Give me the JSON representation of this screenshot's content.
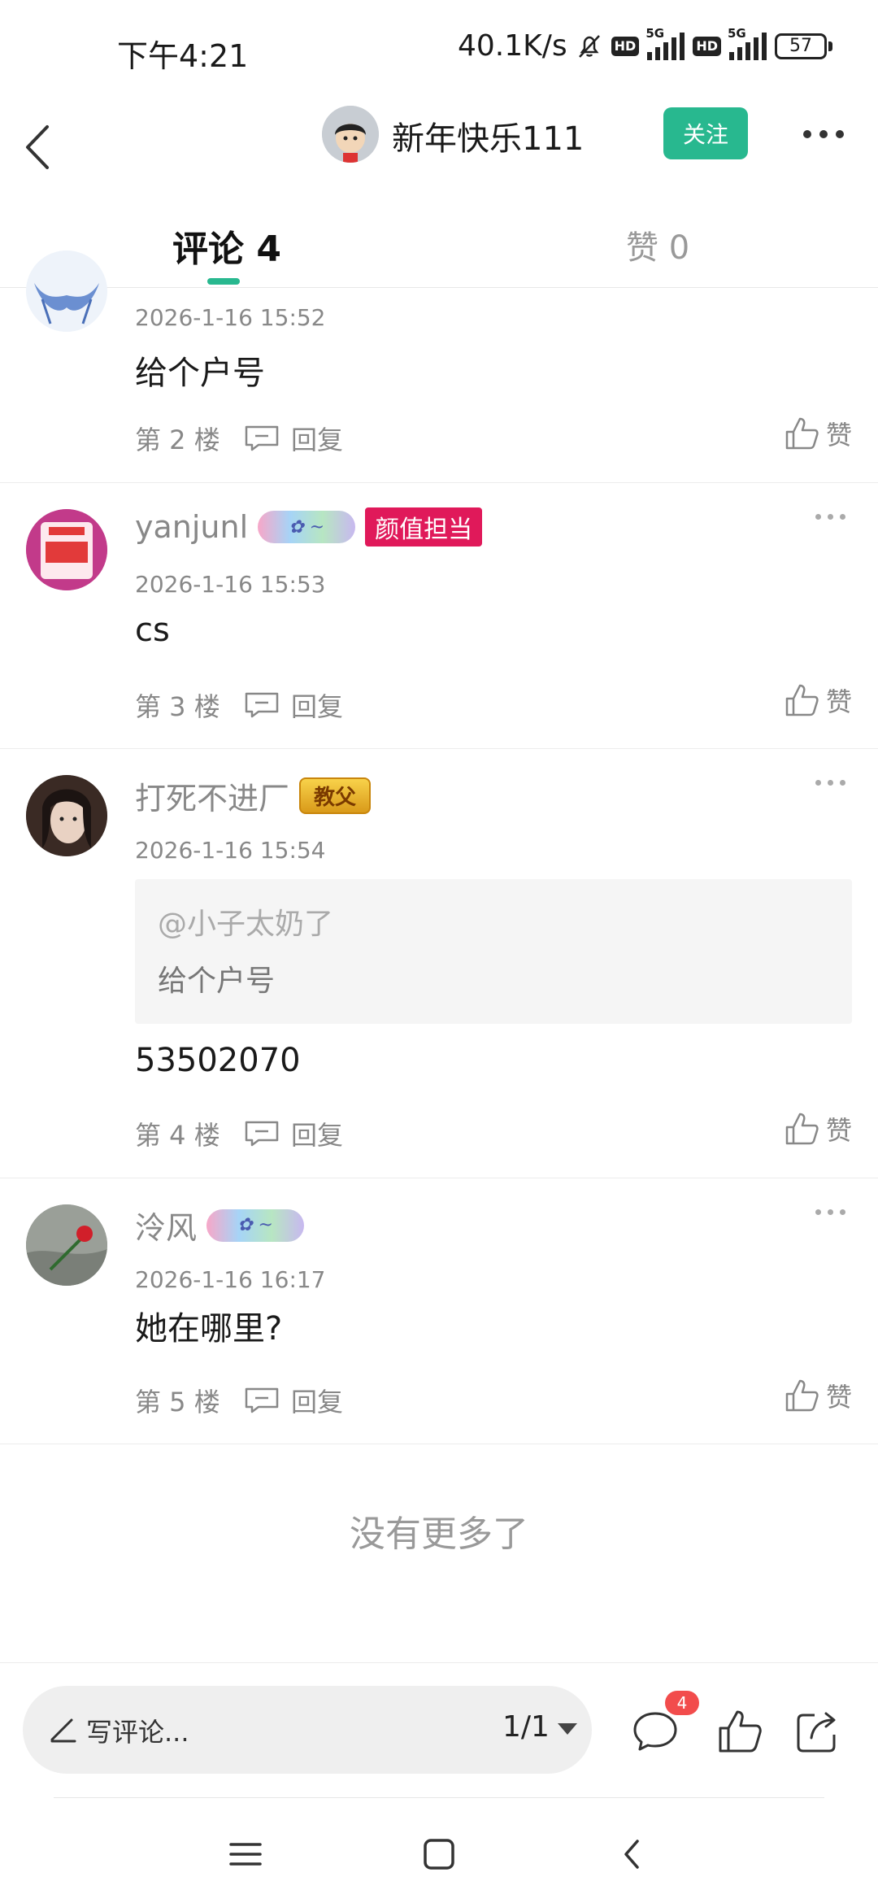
{
  "status_bar": {
    "time": "下午4:21",
    "speed": "40.1K/s",
    "net1": "5G",
    "net2": "5G",
    "hd": "HD",
    "battery": "57"
  },
  "header": {
    "author_name": "新年快乐111",
    "follow_label": "关注"
  },
  "tabs": {
    "comments": "评论 4",
    "likes": "赞 0"
  },
  "comments": [
    {
      "time": "2026-1-16 15:52",
      "text": "给个户号",
      "floor": "第 2 楼",
      "reply": "回复",
      "like": "赞"
    },
    {
      "name": "yanjunl",
      "badge_title": "颜值担当",
      "time": "2026-1-16 15:53",
      "text": "cs",
      "floor": "第 3 楼",
      "reply": "回复",
      "like": "赞"
    },
    {
      "name": "打死不进厂",
      "badge_gold": "教父",
      "time": "2026-1-16 15:54",
      "quote_user": "@小子太奶了",
      "quote_text": "给个户号",
      "text": "53502070",
      "floor": "第 4 楼",
      "reply": "回复",
      "like": "赞"
    },
    {
      "name": "泠风",
      "time": "2026-1-16 16:17",
      "text": "她在哪里?",
      "floor": "第 5 楼",
      "reply": "回复",
      "like": "赞"
    }
  ],
  "footer_text": "没有更多了",
  "bottom_bar": {
    "write_placeholder": "写评论...",
    "page_indicator": "1/1",
    "comment_count_badge": "4"
  },
  "colors": {
    "accent": "#28b88f",
    "badge_red": "#e0195a",
    "notify_red": "#f24c4c"
  }
}
